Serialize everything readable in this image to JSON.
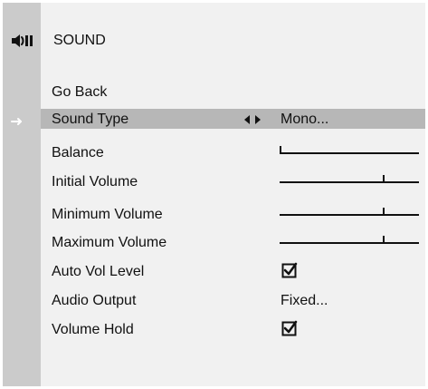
{
  "colors": {
    "sidebar": "#cbcbcb",
    "panel": "#f1f1f1",
    "selected_row": "#b7b7b7",
    "text": "#111111"
  },
  "header": {
    "title": "SOUND",
    "icon": "speaker-icon"
  },
  "menu": {
    "items": [
      {
        "label": "Go Back"
      },
      {
        "label": "Sound Type",
        "value": "Mono...",
        "selected": true
      },
      {
        "label": "Balance",
        "slider_level": 0.0
      },
      {
        "label": "Initial Volume",
        "slider_level": 0.75
      },
      {
        "label": "Minimum Volume",
        "slider_level": 0.75
      },
      {
        "label": "Maximum Volume",
        "slider_level": 0.75
      },
      {
        "label": "Auto Vol Level",
        "checked": true
      },
      {
        "label": "Audio Output",
        "value": "Fixed..."
      },
      {
        "label": "Volume Hold",
        "checked": true
      }
    ]
  }
}
